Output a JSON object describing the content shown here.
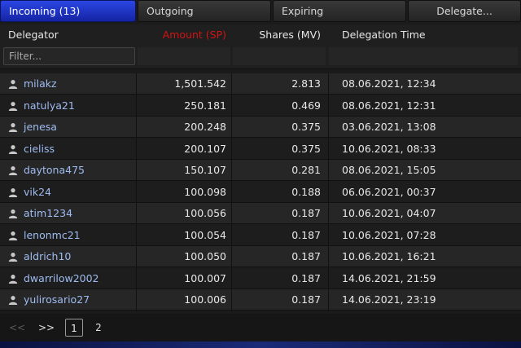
{
  "tabs": [
    {
      "label": "Incoming (13)",
      "active": true
    },
    {
      "label": "Outgoing",
      "active": false
    },
    {
      "label": "Expiring",
      "active": false
    },
    {
      "label": "Delegate...",
      "active": false
    }
  ],
  "table": {
    "headers": [
      "Delegator",
      "Amount (SP)",
      "Shares (MV)",
      "Delegation Time"
    ],
    "filter_placeholder": "Filter...",
    "filter_value": "",
    "rows": [
      {
        "delegator": "milakz",
        "amount": "1,501.542",
        "shares": "2.813",
        "time": "08.06.2021, 12:34"
      },
      {
        "delegator": "natulya21",
        "amount": "250.181",
        "shares": "0.469",
        "time": "08.06.2021, 12:31"
      },
      {
        "delegator": "jenesa",
        "amount": "200.248",
        "shares": "0.375",
        "time": "03.06.2021, 13:08"
      },
      {
        "delegator": "cieliss",
        "amount": "200.107",
        "shares": "0.375",
        "time": "10.06.2021, 08:33"
      },
      {
        "delegator": "daytona475",
        "amount": "150.107",
        "shares": "0.281",
        "time": "08.06.2021, 15:05"
      },
      {
        "delegator": "vik24",
        "amount": "100.098",
        "shares": "0.188",
        "time": "06.06.2021, 00:37"
      },
      {
        "delegator": "atim1234",
        "amount": "100.056",
        "shares": "0.187",
        "time": "10.06.2021, 04:07"
      },
      {
        "delegator": "lenonmc21",
        "amount": "100.054",
        "shares": "0.187",
        "time": "10.06.2021, 07:28"
      },
      {
        "delegator": "aldrich10",
        "amount": "100.050",
        "shares": "0.187",
        "time": "10.06.2021, 16:21"
      },
      {
        "delegator": "dwarrilow2002",
        "amount": "100.007",
        "shares": "0.187",
        "time": "14.06.2021, 21:59"
      },
      {
        "delegator": "yulirosario27",
        "amount": "100.006",
        "shares": "0.187",
        "time": "14.06.2021, 23:19"
      }
    ]
  },
  "pager": {
    "prev": "<<",
    "next": ">>",
    "pages": [
      "1",
      "2"
    ],
    "current": "1"
  },
  "colors": {
    "active_tab": "#1f36c8",
    "amount_header": "#d11414",
    "link": "#9fbcf0"
  },
  "icons": {
    "row_icon": "user-icon"
  }
}
